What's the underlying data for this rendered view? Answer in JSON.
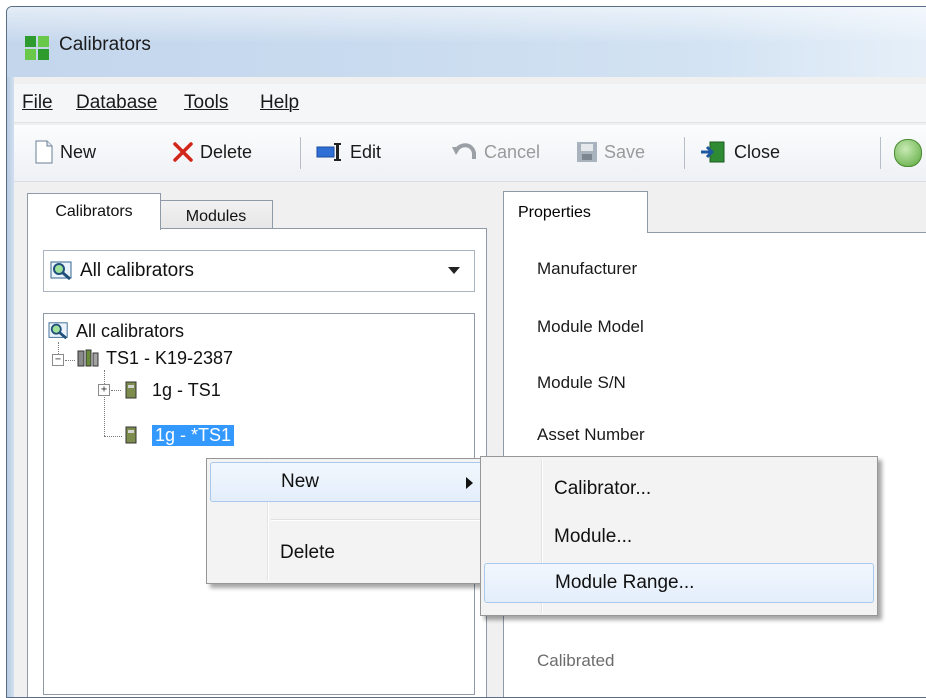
{
  "window": {
    "title": "Calibrators"
  },
  "menubar": {
    "items": [
      {
        "label": "File"
      },
      {
        "label": "Database"
      },
      {
        "label": "Tools"
      },
      {
        "label": "Help"
      }
    ]
  },
  "toolbar": {
    "new_label": "New",
    "delete_label": "Delete",
    "edit_label": "Edit",
    "cancel_label": "Cancel",
    "save_label": "Save",
    "close_label": "Close"
  },
  "left_tabs": [
    {
      "label": "Calibrators"
    },
    {
      "label": "Modules"
    }
  ],
  "filter_combo": {
    "value": "All calibrators"
  },
  "tree": {
    "root": "All calibrators",
    "calibrator": "TS1 - K19-2387",
    "module_1": "1g - TS1",
    "module_2": "1g - *TS1"
  },
  "right_tab": {
    "label": "Properties"
  },
  "properties": [
    {
      "label": "Manufacturer"
    },
    {
      "label": "Module Model"
    },
    {
      "label": "Module S/N"
    },
    {
      "label": "Asset Number"
    },
    {
      "label": "Calibrated"
    }
  ],
  "context_menu": {
    "new_label": "New",
    "delete_label": "Delete"
  },
  "submenu": {
    "items": [
      {
        "label": "Calibrator..."
      },
      {
        "label": "Module..."
      },
      {
        "label": "Module Range..."
      }
    ]
  },
  "colors": {
    "selection": "#3399ff",
    "title_gradient_start": "#c3d6ec",
    "window_bg": "#f0f0f0"
  }
}
